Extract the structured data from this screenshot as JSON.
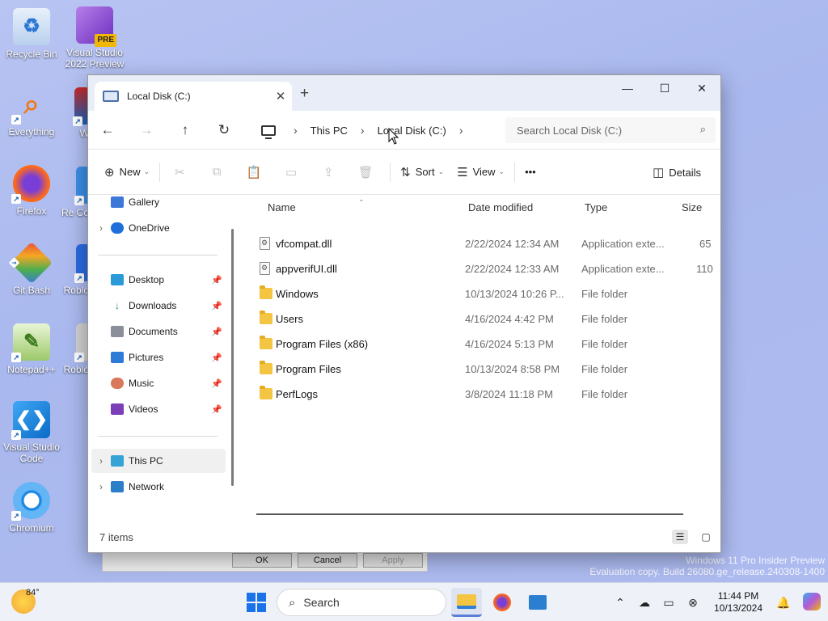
{
  "desktop": {
    "icons": [
      {
        "label": "Recycle Bin"
      },
      {
        "label": "Visual Studio 2022 Preview",
        "badge": "PRE"
      },
      {
        "label": "Everything"
      },
      {
        "label": "Firefox"
      },
      {
        "label": "Git Bash"
      },
      {
        "label": "Notepad++"
      },
      {
        "label": "Visual Studio Code"
      },
      {
        "label": "Chromium"
      },
      {
        "label": "W"
      },
      {
        "label": "Re Co"
      },
      {
        "label": "Roblo"
      },
      {
        "label": "Roblo"
      }
    ],
    "watermark": {
      "line1": "Windows 11 Pro Insider Preview",
      "line2": "Evaluation copy. Build 26080.ge_release.240308-1400"
    },
    "behind_dialog": {
      "ok": "OK",
      "cancel": "Cancel",
      "apply": "Apply"
    }
  },
  "window": {
    "tab_title": "Local Disk (C:)",
    "new_tab": "+",
    "address": {
      "root": "This PC",
      "current": "Local Disk (C:)"
    },
    "search_placeholder": "Search Local Disk (C:)",
    "commands": {
      "new": "New",
      "sort": "Sort",
      "view": "View",
      "more": "•••",
      "details": "Details"
    },
    "sidebar": {
      "top": [
        {
          "label": "Gallery"
        },
        {
          "label": "OneDrive"
        }
      ],
      "pinned": [
        {
          "label": "Desktop"
        },
        {
          "label": "Downloads"
        },
        {
          "label": "Documents"
        },
        {
          "label": "Pictures"
        },
        {
          "label": "Music"
        },
        {
          "label": "Videos"
        }
      ],
      "bottom": [
        {
          "label": "This PC"
        },
        {
          "label": "Network"
        }
      ]
    },
    "columns": {
      "name": "Name",
      "date": "Date modified",
      "type": "Type",
      "size": "Size"
    },
    "files": [
      {
        "name": "vfcompat.dll",
        "date": "2/22/2024 12:34 AM",
        "type": "Application exte...",
        "size": "65",
        "kind": "dll"
      },
      {
        "name": "appverifUI.dll",
        "date": "2/22/2024 12:33 AM",
        "type": "Application exte...",
        "size": "110",
        "kind": "dll"
      },
      {
        "name": "Windows",
        "date": "10/13/2024 10:26 P...",
        "type": "File folder",
        "size": "",
        "kind": "folder"
      },
      {
        "name": "Users",
        "date": "4/16/2024 4:42 PM",
        "type": "File folder",
        "size": "",
        "kind": "folder"
      },
      {
        "name": "Program Files (x86)",
        "date": "4/16/2024 5:13 PM",
        "type": "File folder",
        "size": "",
        "kind": "folder"
      },
      {
        "name": "Program Files",
        "date": "10/13/2024 8:58 PM",
        "type": "File folder",
        "size": "",
        "kind": "folder"
      },
      {
        "name": "PerfLogs",
        "date": "3/8/2024 11:18 PM",
        "type": "File folder",
        "size": "",
        "kind": "folder"
      }
    ],
    "status": {
      "item_count": "7 items"
    }
  },
  "taskbar": {
    "weather_temp": "84°",
    "search_label": "Search",
    "clock_time": "11:44 PM",
    "clock_date": "10/13/2024"
  }
}
